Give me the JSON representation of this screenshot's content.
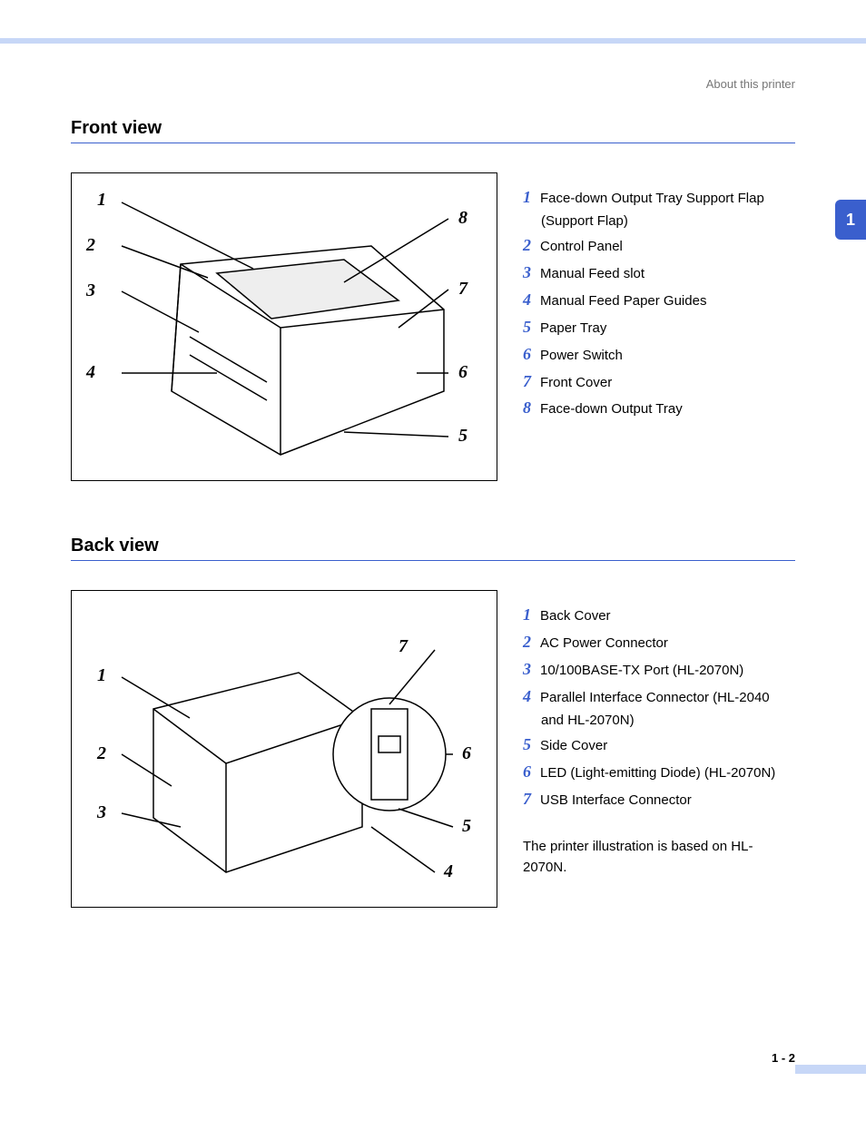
{
  "header": {
    "running_head": "About this printer"
  },
  "side_tab": "1",
  "page_number": "1 - 2",
  "sections": {
    "front": {
      "heading": "Front view",
      "callouts": [
        "1",
        "2",
        "3",
        "4",
        "5",
        "6",
        "7",
        "8"
      ],
      "legend": [
        {
          "num": "1",
          "text": "Face-down Output Tray Support Flap (Support Flap)"
        },
        {
          "num": "2",
          "text": "Control Panel"
        },
        {
          "num": "3",
          "text": "Manual Feed slot"
        },
        {
          "num": "4",
          "text": "Manual Feed Paper Guides"
        },
        {
          "num": "5",
          "text": "Paper Tray"
        },
        {
          "num": "6",
          "text": "Power Switch"
        },
        {
          "num": "7",
          "text": "Front Cover"
        },
        {
          "num": "8",
          "text": "Face-down Output Tray"
        }
      ]
    },
    "back": {
      "heading": "Back view",
      "callouts": [
        "1",
        "2",
        "3",
        "4",
        "5",
        "6",
        "7"
      ],
      "legend": [
        {
          "num": "1",
          "text": "Back Cover"
        },
        {
          "num": "2",
          "text": "AC Power Connector"
        },
        {
          "num": "3",
          "text": "10/100BASE-TX Port (HL-2070N)"
        },
        {
          "num": "4",
          "text": "Parallel Interface Connector (HL-2040 and HL-2070N)"
        },
        {
          "num": "5",
          "text": "Side Cover"
        },
        {
          "num": "6",
          "text": "LED (Light-emitting Diode) (HL-2070N)"
        },
        {
          "num": "7",
          "text": "USB Interface Connector"
        }
      ],
      "note": "The printer illustration is based on HL-2070N."
    }
  }
}
